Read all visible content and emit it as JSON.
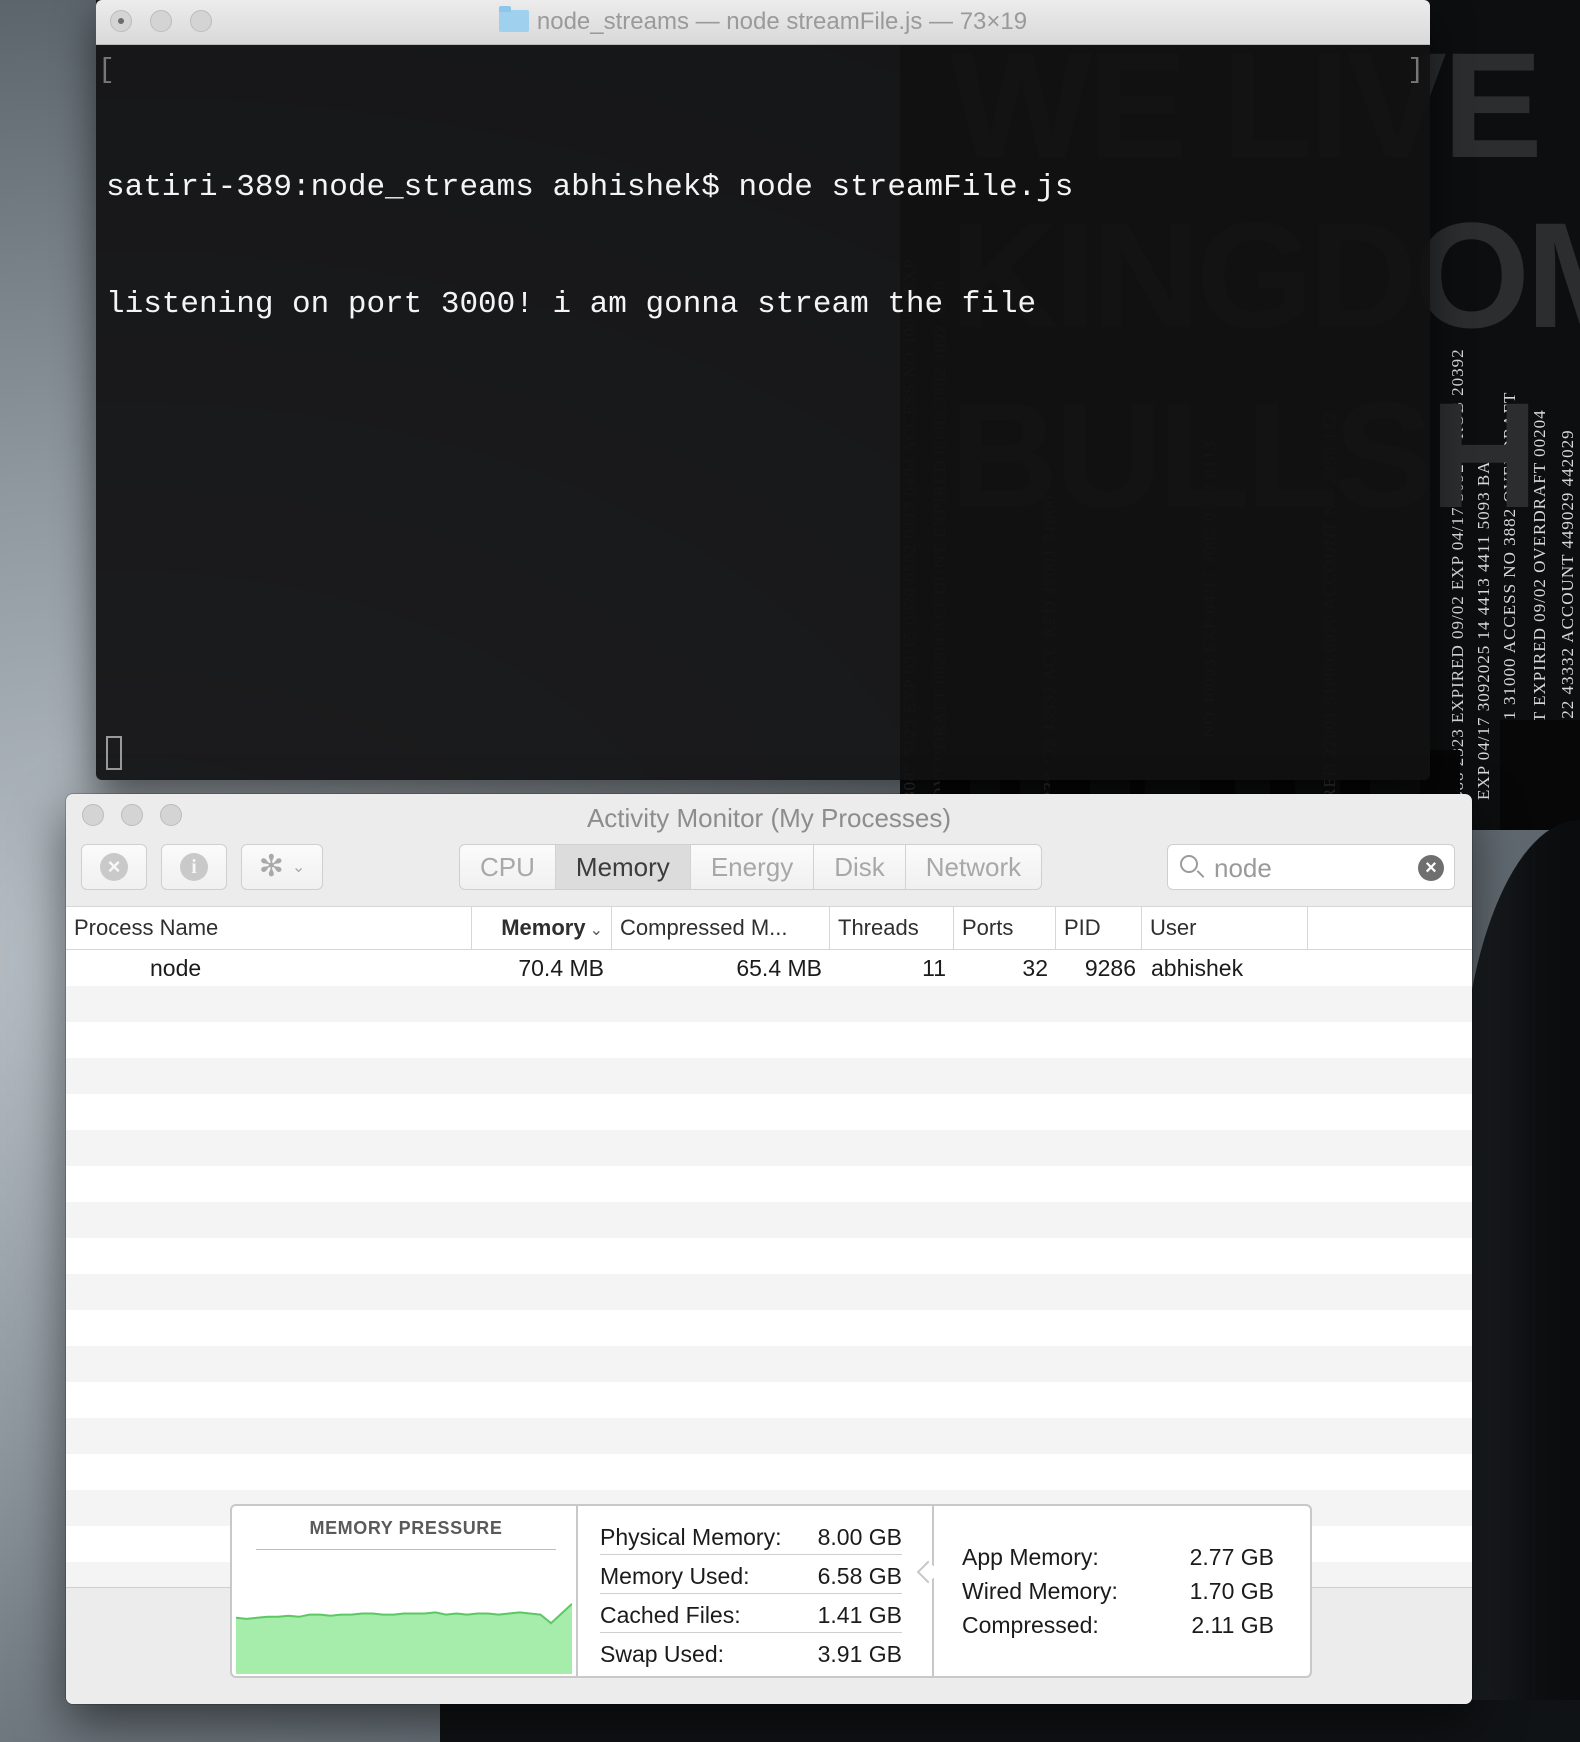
{
  "terminal": {
    "title": "node_streams — node streamFile.js — 73×19",
    "lines": [
      "satiri-389:node_streams abhishek$ node streamFile.js",
      "listening on port 3000! i am gonna stream the file"
    ]
  },
  "activity_monitor": {
    "title": "Activity Monitor (My Processes)",
    "tabs": [
      {
        "label": "CPU",
        "active": false
      },
      {
        "label": "Memory",
        "active": true
      },
      {
        "label": "Energy",
        "active": false
      },
      {
        "label": "Disk",
        "active": false
      },
      {
        "label": "Network",
        "active": false
      }
    ],
    "search": {
      "value": "node"
    },
    "columns": {
      "process_name": "Process Name",
      "memory": "Memory",
      "compressed": "Compressed M...",
      "threads": "Threads",
      "ports": "Ports",
      "pid": "PID",
      "user": "User"
    },
    "sorted_column": "memory",
    "rows": [
      {
        "name": "node",
        "memory": "70.4 MB",
        "compressed": "65.4 MB",
        "threads": "11",
        "ports": "32",
        "pid": "9286",
        "user": "abhishek"
      }
    ],
    "memory_pressure": {
      "label": "MEMORY PRESSURE",
      "color": "#a6ecaa",
      "line_color": "#5cc864",
      "level_series": [
        0.52,
        0.51,
        0.52,
        0.53,
        0.53,
        0.54,
        0.53,
        0.55,
        0.55,
        0.54,
        0.55,
        0.55,
        0.56,
        0.56,
        0.55,
        0.55,
        0.56,
        0.56,
        0.56,
        0.57,
        0.55,
        0.56,
        0.55,
        0.56,
        0.56,
        0.55,
        0.56,
        0.57,
        0.56,
        0.55,
        0.47,
        0.56,
        0.65
      ]
    },
    "stats": [
      {
        "label": "Physical Memory:",
        "value": "8.00 GB"
      },
      {
        "label": "Memory Used:",
        "value": "6.58 GB"
      },
      {
        "label": "Cached Files:",
        "value": "1.41 GB"
      },
      {
        "label": "Swap Used:",
        "value": "3.91 GB"
      }
    ],
    "stats_detail": [
      {
        "label": "App Memory:",
        "value": "2.77 GB"
      },
      {
        "label": "Wired Memory:",
        "value": "1.70 GB"
      },
      {
        "label": "Compressed:",
        "value": "2.11 GB"
      }
    ]
  },
  "wallpaper": {
    "headline_lines": [
      "WE LIVE IN",
      "KINGDOM",
      "BULLSH"
    ]
  }
}
